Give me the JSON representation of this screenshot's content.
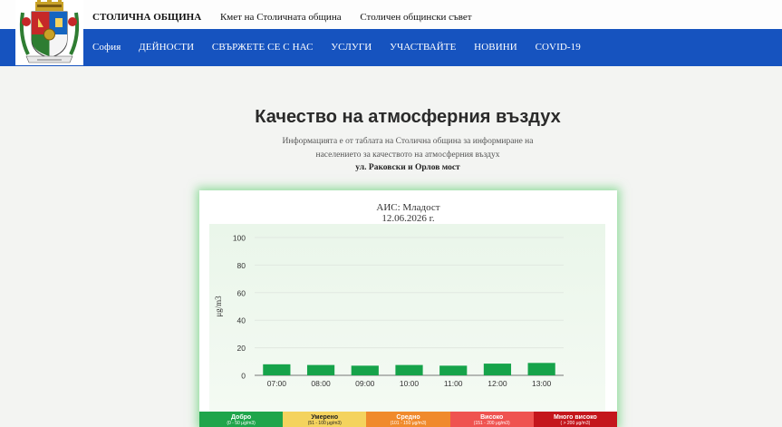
{
  "header": {
    "brand": "СТОЛИЧНА ОБЩИНА",
    "links": [
      "Кмет на Столичната община",
      "Столичен общински съвет"
    ]
  },
  "nav": {
    "items": [
      "София",
      "ДЕЙНОСТИ",
      "СВЪРЖЕТЕ СЕ С НАС",
      "УСЛУГИ",
      "УЧАСТВАЙТЕ",
      "НОВИНИ",
      "COVID-19"
    ],
    "bg": "#1653bf"
  },
  "page": {
    "title": "Качество на атмосферния въздух",
    "subtitle_line1": "Информацията е от таблата на Столична община за информиране на",
    "subtitle_line2": "населението за качеството на атмосферния въздух",
    "address": "ул. Раковски и Орлов мост"
  },
  "chart_data": {
    "type": "bar",
    "title": "АИС: Младост",
    "subtitle": "12.06.2026 г.",
    "ylabel": "μg/m3",
    "categories": [
      "07:00",
      "08:00",
      "09:00",
      "10:00",
      "11:00",
      "12:00",
      "13:00"
    ],
    "values": [
      8,
      7.5,
      7,
      7.5,
      7,
      8.5,
      9
    ],
    "ylim": [
      0,
      100
    ],
    "yticks": [
      0,
      20,
      40,
      60,
      80,
      100
    ],
    "bar_color": "#16a34a",
    "grid": true
  },
  "legend": [
    {
      "label": "Добро",
      "range": "(0 - 50 μg/m3)",
      "color": "#1fa54b"
    },
    {
      "label": "Умерено",
      "range": "(51 - 100 μg/m3)",
      "color": "#f4d35e"
    },
    {
      "label": "Средно",
      "range": "(101 - 150 μg/m3)",
      "color": "#f08a2c"
    },
    {
      "label": "Високо",
      "range": "(151 - 200 μg/m3)",
      "color": "#ef5350"
    },
    {
      "label": "Много високо",
      "range": "( > 200 μg/m3)",
      "color": "#c4161c"
    }
  ]
}
